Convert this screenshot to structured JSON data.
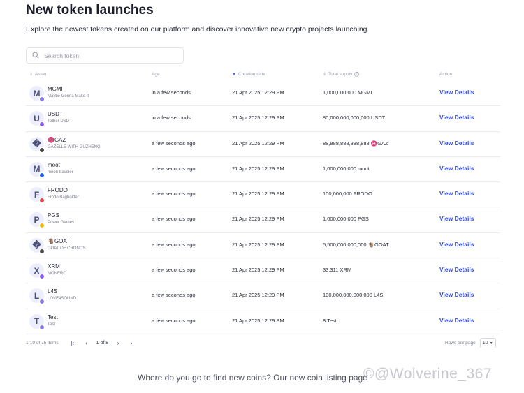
{
  "header": {
    "title": "New token launches",
    "subtitle": "Explore the newest tokens created on our platform and discover innovative new crypto projects launching."
  },
  "search": {
    "placeholder": "Search token",
    "value": ""
  },
  "table": {
    "columns": {
      "asset": "Asset",
      "age": "Age",
      "creation_date": "Creation date",
      "total_supply": "Total supply",
      "action": "Action"
    },
    "rows": [
      {
        "avatar": "M",
        "symbol": "MGMI",
        "name": "Maybe Gonna Make It",
        "age": "in a few seconds",
        "date": "21 Apr 2025 12:29 PM",
        "supply": "1,000,000,000 MGMI",
        "action": "View Details",
        "chain_color": "#8b7de8"
      },
      {
        "avatar": "U",
        "symbol": "USDT",
        "name": "Tether USD",
        "age": "in a few seconds",
        "date": "21 Apr 2025 12:29 PM",
        "supply": "80,000,000,000,000 USDT",
        "action": "View Details",
        "chain_color": "#8b5cf6"
      },
      {
        "avatar": "�",
        "symbol": "♓GAZ",
        "name": "GAZELLE WITH GUZHENG",
        "age": "a few seconds ago",
        "date": "21 Apr 2025 12:29 PM",
        "supply": "88,888,888,888,888 ♓GAZ",
        "action": "View Details",
        "chain_color": "#4a4a4a"
      },
      {
        "avatar": "M",
        "symbol": "moot",
        "name": "moon traveler",
        "age": "a few seconds ago",
        "date": "21 Apr 2025 12:29 PM",
        "supply": "1,000,000,000 moot",
        "action": "View Details",
        "chain_color": "#2563eb"
      },
      {
        "avatar": "F",
        "symbol": "FRODO",
        "name": "Frodo Bagholder",
        "age": "a few seconds ago",
        "date": "21 Apr 2025 12:29 PM",
        "supply": "100,000,000 FRODO",
        "action": "View Details",
        "chain_color": "#e5484d"
      },
      {
        "avatar": "P",
        "symbol": "PGS",
        "name": "Power Games",
        "age": "a few seconds ago",
        "date": "21 Apr 2025 12:29 PM",
        "supply": "1,000,000,000 PGS",
        "action": "View Details",
        "chain_color": "#f0b90b"
      },
      {
        "avatar": "�",
        "symbol": "🐐GOAT",
        "name": "GOAT OF CRONOS",
        "age": "a few seconds ago",
        "date": "21 Apr 2025 12:29 PM",
        "supply": "5,500,000,000,000 🐐GOAT",
        "action": "View Details",
        "chain_color": "#4a4a4a"
      },
      {
        "avatar": "X",
        "symbol": "XRM",
        "name": "MONERO",
        "age": "a few seconds ago",
        "date": "21 Apr 2025 12:29 PM",
        "supply": "33,311 XRM",
        "action": "View Details",
        "chain_color": "#8b5cf6"
      },
      {
        "avatar": "L",
        "symbol": "L4S",
        "name": "LOVE4SOUND",
        "age": "a few seconds ago",
        "date": "21 Apr 2025 12:29 PM",
        "supply": "100,000,000,000,000 L4S",
        "action": "View Details",
        "chain_color": "#8b7de8"
      },
      {
        "avatar": "T",
        "symbol": "Test",
        "name": "Test",
        "age": "a few seconds ago",
        "date": "21 Apr 2025 12:29 PM",
        "supply": "8 Test",
        "action": "View Details",
        "chain_color": "#8b7de8"
      }
    ]
  },
  "pagination": {
    "count": "1-10 of 75 items",
    "page_text": "1 of 8",
    "rows_per_page_label": "Rows per page",
    "rows_per_page_value": "10"
  },
  "footer": {
    "text": "Where do you go to find new coins? Our new coin listing page",
    "watermark": "©@Wolverine_367"
  },
  "colors": {
    "accent": "#2f46d6",
    "avatar_bg": "#eceefb"
  }
}
